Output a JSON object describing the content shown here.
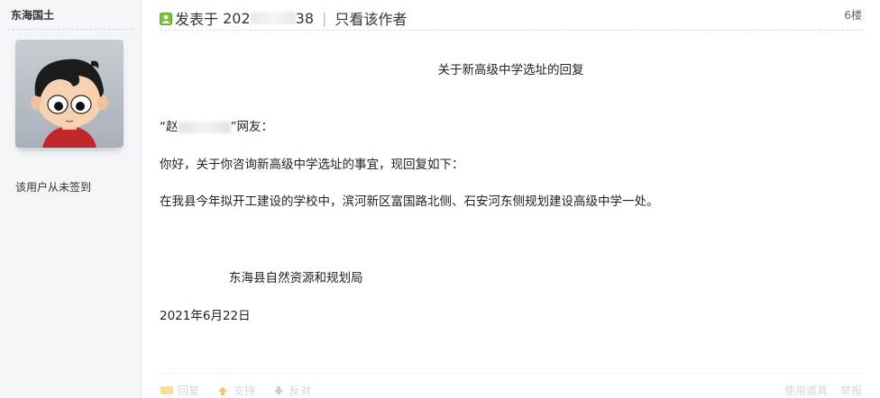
{
  "author": {
    "name": "东海国土",
    "sign_status": "该用户从未签到"
  },
  "meta": {
    "posted_prefix": "发表于",
    "posted_date_visible_start": "202",
    "posted_date_visible_end": "38",
    "only_author": "只看该作者",
    "floor": "6楼"
  },
  "post": {
    "title": "关于新高级中学选址的回复",
    "salutation_open": "“赵",
    "salutation_close": "”网友：",
    "greeting": "你好，关于你咨询新高级中学选址的事宜，现回复如下：",
    "answer": "在我县今年拟开工建设的学校中，滨河新区富国路北侧、石安河东侧规划建设高级中学一处。",
    "signature": "东海县自然资源和规划局",
    "date": "2021年6月22日"
  },
  "footer": {
    "reply": "回复",
    "support": "支持",
    "oppose": "反对",
    "tools": "使用道具",
    "report": "举报"
  },
  "colors": {
    "sidebar_bg": "#f3f5f8",
    "online_icon": "#7cc142"
  }
}
